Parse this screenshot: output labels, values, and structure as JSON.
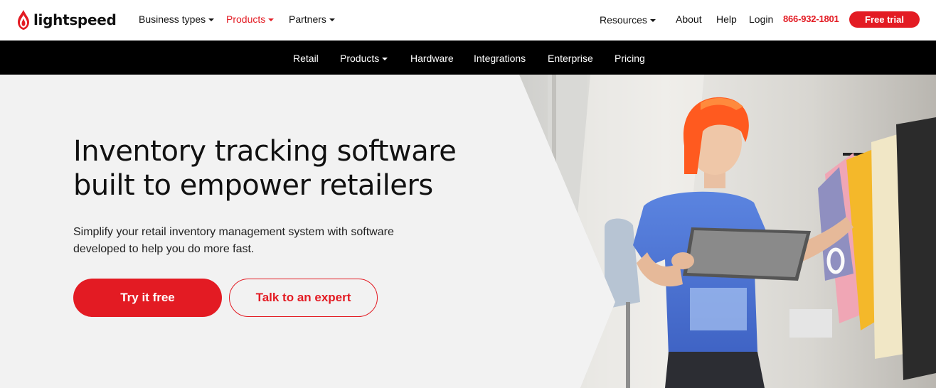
{
  "brand": {
    "name": "lightspeed",
    "color": "#e31b23"
  },
  "topnav": {
    "business_types": "Business types",
    "products": "Products",
    "partners": "Partners",
    "resources": "Resources",
    "about": "About",
    "help": "Help",
    "login": "Login",
    "phone": "866-932-1801",
    "free_trial": "Free trial"
  },
  "subnav": {
    "items": [
      "Retail",
      "Products",
      "Hardware",
      "Integrations",
      "Enterprise",
      "Pricing"
    ]
  },
  "hero": {
    "title_line1": "Inventory tracking software",
    "title_line2": "built to empower retailers",
    "desc_line1": "Simplify your retail inventory management system with software",
    "desc_line2": "developed to help you do more fast.",
    "cta_primary": "Try it free",
    "cta_secondary": "Talk to an expert"
  },
  "icons": [
    "lightspeed-flame-icon",
    "chevron-down-icon"
  ]
}
